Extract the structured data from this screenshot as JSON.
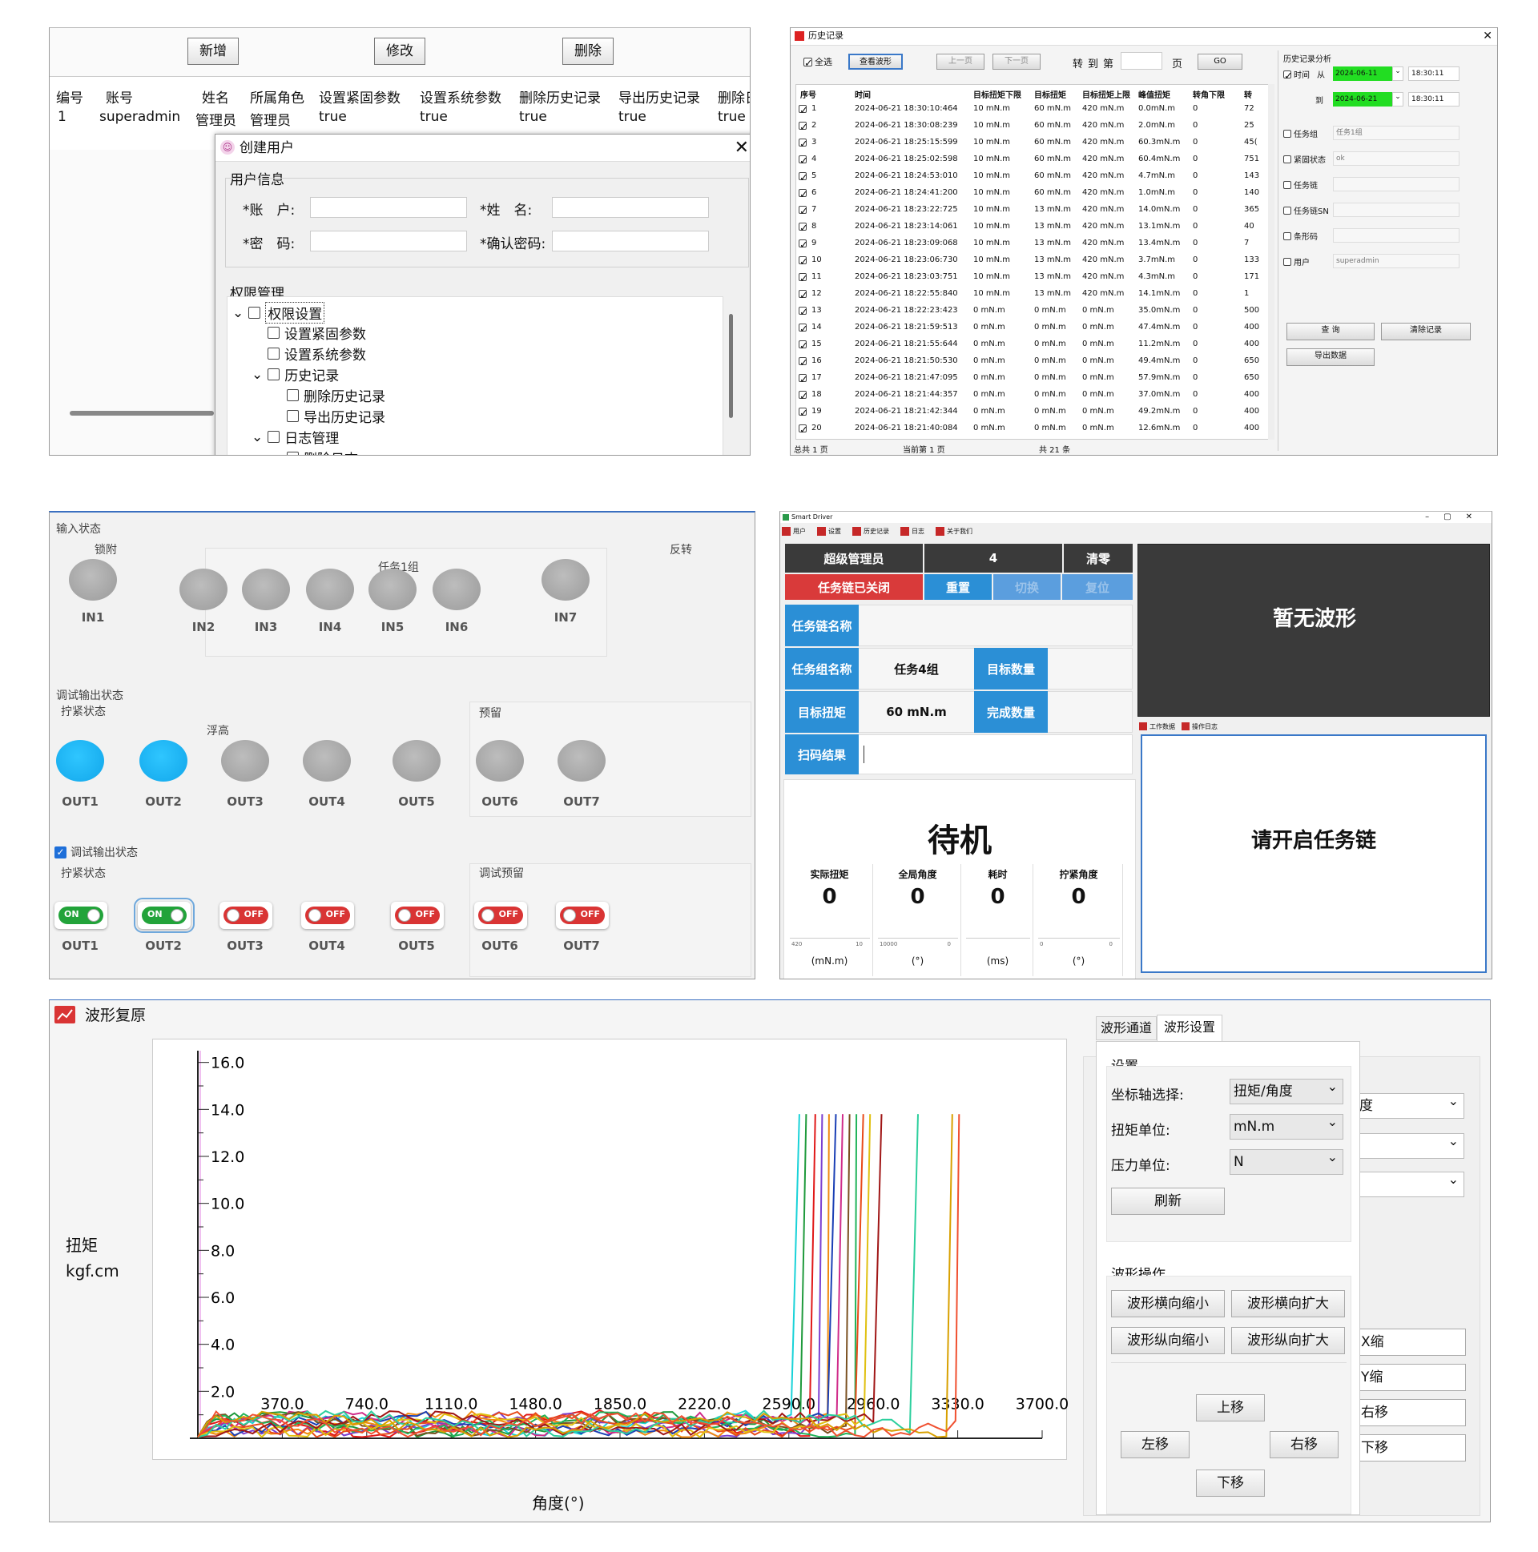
{
  "p1": {
    "buttons": [
      "新增",
      "修改",
      "删除"
    ],
    "headers": [
      "编号",
      "账号",
      "姓名",
      "所属角色",
      "设置紧固参数",
      "设置系统参数",
      "删除历史记录",
      "导出历史记录",
      "删除日"
    ],
    "row": [
      "1",
      "superadmin",
      "管理员",
      "管理员",
      "true",
      "true",
      "true",
      "true",
      "true"
    ],
    "dialog": {
      "title": "创建用户",
      "user_info": "用户信息",
      "account": "*账　户:",
      "surname": "*姓　名:",
      "password": "*密　码:",
      "confirm": "*确认密码:",
      "perm": "权限管理",
      "tree": [
        "权限设置",
        "设置紧固参数",
        "设置系统参数",
        "历史记录",
        "删除历史记录",
        "导出历史记录",
        "日志管理",
        "删除日志"
      ]
    }
  },
  "p2": {
    "title": "历史记录",
    "toolbar": {
      "select_all": "全选",
      "view_wave": "查看波形",
      "prev": "上一页",
      "next": "下一页",
      "goto": "转到第",
      "page": "页",
      "go": "GO"
    },
    "headers": [
      "序号",
      "时间",
      "目标扭矩下限",
      "目标扭矩",
      "目标扭矩上限",
      "峰值扭矩",
      "转角下限",
      "转"
    ],
    "rows": [
      [
        "1",
        "2024-06-21 18:30:10:464",
        "10 mN.m",
        "60 mN.m",
        "420 mN.m",
        "0.0mN.m",
        "0",
        "72"
      ],
      [
        "2",
        "2024-06-21 18:30:08:239",
        "10 mN.m",
        "60 mN.m",
        "420 mN.m",
        "2.0mN.m",
        "0",
        "25"
      ],
      [
        "3",
        "2024-06-21 18:25:15:599",
        "10 mN.m",
        "60 mN.m",
        "420 mN.m",
        "60.3mN.m",
        "0",
        "45("
      ],
      [
        "4",
        "2024-06-21 18:25:02:598",
        "10 mN.m",
        "60 mN.m",
        "420 mN.m",
        "60.4mN.m",
        "0",
        "751"
      ],
      [
        "5",
        "2024-06-21 18:24:53:010",
        "10 mN.m",
        "60 mN.m",
        "420 mN.m",
        "4.7mN.m",
        "0",
        "143"
      ],
      [
        "6",
        "2024-06-21 18:24:41:200",
        "10 mN.m",
        "60 mN.m",
        "420 mN.m",
        "1.0mN.m",
        "0",
        "140"
      ],
      [
        "7",
        "2024-06-21 18:23:22:725",
        "10 mN.m",
        "13 mN.m",
        "420 mN.m",
        "14.0mN.m",
        "0",
        "365"
      ],
      [
        "8",
        "2024-06-21 18:23:14:061",
        "10 mN.m",
        "13 mN.m",
        "420 mN.m",
        "13.1mN.m",
        "0",
        "40"
      ],
      [
        "9",
        "2024-06-21 18:23:09:068",
        "10 mN.m",
        "13 mN.m",
        "420 mN.m",
        "13.4mN.m",
        "0",
        "7"
      ],
      [
        "10",
        "2024-06-21 18:23:06:730",
        "10 mN.m",
        "13 mN.m",
        "420 mN.m",
        "3.7mN.m",
        "0",
        "133"
      ],
      [
        "11",
        "2024-06-21 18:23:03:751",
        "10 mN.m",
        "13 mN.m",
        "420 mN.m",
        "4.3mN.m",
        "0",
        "171"
      ],
      [
        "12",
        "2024-06-21 18:22:55:840",
        "10 mN.m",
        "13 mN.m",
        "420 mN.m",
        "14.1mN.m",
        "0",
        "1"
      ],
      [
        "13",
        "2024-06-21 18:22:23:423",
        "0 mN.m",
        "0 mN.m",
        "0 mN.m",
        "35.0mN.m",
        "0",
        "500"
      ],
      [
        "14",
        "2024-06-21 18:21:59:513",
        "0 mN.m",
        "0 mN.m",
        "0 mN.m",
        "47.4mN.m",
        "0",
        "400"
      ],
      [
        "15",
        "2024-06-21 18:21:55:644",
        "0 mN.m",
        "0 mN.m",
        "0 mN.m",
        "11.2mN.m",
        "0",
        "400"
      ],
      [
        "16",
        "2024-06-21 18:21:50:530",
        "0 mN.m",
        "0 mN.m",
        "0 mN.m",
        "49.4mN.m",
        "0",
        "650"
      ],
      [
        "17",
        "2024-06-21 18:21:47:095",
        "0 mN.m",
        "0 mN.m",
        "0 mN.m",
        "57.9mN.m",
        "0",
        "650"
      ],
      [
        "18",
        "2024-06-21 18:21:44:357",
        "0 mN.m",
        "0 mN.m",
        "0 mN.m",
        "37.0mN.m",
        "0",
        "400"
      ],
      [
        "19",
        "2024-06-21 18:21:42:344",
        "0 mN.m",
        "0 mN.m",
        "0 mN.m",
        "49.2mN.m",
        "0",
        "400"
      ],
      [
        "20",
        "2024-06-21 18:21:40:084",
        "0 mN.m",
        "0 mN.m",
        "0 mN.m",
        "12.6mN.m",
        "0",
        "400"
      ]
    ],
    "footer": {
      "total_pages": "总共 1 页",
      "current": "当前第 1 页",
      "total": "共 21 条"
    },
    "analysis": {
      "title": "历史记录分析",
      "time": "时间",
      "from": "从",
      "to": "到",
      "date_from": "2024-06-11",
      "date_to": "2024-06-21",
      "time_from": "18:30:11",
      "time_to": "18:30:11",
      "filters": [
        {
          "label": "任务组",
          "value": "任务1组"
        },
        {
          "label": "紧固状态",
          "value": "ok"
        },
        {
          "label": "任务链",
          "value": ""
        },
        {
          "label": "任务链SN",
          "value": ""
        },
        {
          "label": "条形码",
          "value": ""
        },
        {
          "label": "用户",
          "value": "superadmin"
        }
      ],
      "query": "查 询",
      "clear": "清除记录",
      "export": "导出数据"
    }
  },
  "p3": {
    "input_title": "输入状态",
    "lock": "锁附",
    "task_group": "任务1组",
    "reverse": "反转",
    "inputs": [
      "IN1",
      "IN2",
      "IN3",
      "IN4",
      "IN5",
      "IN6",
      "IN7"
    ],
    "debug_out_title": "调试输出状态",
    "tighten": "拧紧状态",
    "float": "浮高",
    "reserve": "预留",
    "outputs": [
      "OUT1",
      "OUT2",
      "OUT3",
      "OUT4",
      "OUT5",
      "OUT6",
      "OUT7"
    ],
    "debug_switch_title": "调试输出状态",
    "tighten2": "拧紧状态",
    "debug_reserve": "调试预留",
    "on": "ON",
    "off": "OFF"
  },
  "p4": {
    "window_title": "Smart Driver",
    "menu": [
      "用户",
      "设置",
      "历史记录",
      "日志",
      "关于我们"
    ],
    "admin": "超级管理员",
    "num": "4",
    "clear": "清零",
    "chain_closed": "任务链已关闭",
    "reset": "重置",
    "switch": "切换",
    "restore": "复位",
    "chain_name": "任务链名称",
    "group_name": "任务组名称",
    "group_val": "任务4组",
    "target_count": "目标数量",
    "target_torque": "目标扭矩",
    "torque_val": "60 mN.m",
    "done_count": "完成数量",
    "scan": "扫码结果",
    "standby": "待机",
    "metrics": [
      {
        "label": "实际扭矩",
        "value": "0",
        "min": "420",
        "max": "10",
        "unit": "(mN.m)"
      },
      {
        "label": "全局角度",
        "value": "0",
        "min": "10000",
        "max": "0",
        "unit": "(°)"
      },
      {
        "label": "耗时",
        "value": "0",
        "min": "",
        "max": "",
        "unit": "(ms)"
      },
      {
        "label": "拧紧角度",
        "value": "0",
        "min": "0",
        "max": "0",
        "unit": "(°)"
      }
    ],
    "no_wave": "暂无波形",
    "tabs": [
      "工作数据",
      "操作日志"
    ],
    "prompt": "请开启任务链"
  },
  "p5": {
    "title": "波形复原",
    "ylabel1": "扭矩",
    "ylabel2": "kgf.cm",
    "xlabel": "角度(°)",
    "yticks": [
      "16.0",
      "14.0",
      "12.0",
      "10.0",
      "8.0",
      "6.0",
      "4.0",
      "2.0"
    ],
    "xticks": [
      "370.0",
      "740.0",
      "1110.0",
      "1480.0",
      "1850.0",
      "2220.0",
      "2590.0",
      "2960.0",
      "3330.0",
      "3700.0"
    ],
    "tabs": [
      "波形通道",
      "波形设置"
    ],
    "settings": "设置",
    "axis_sel": "坐标轴选择:",
    "axis_val": "扭矩/角度",
    "torque_unit": "扭矩单位:",
    "torque_val": "mN.m",
    "force_unit": "压力单位:",
    "force_val": "N",
    "refresh": "刷新",
    "wave_ops": "波形操作",
    "h_shrink": "波形横向缩小",
    "h_expand": "波形横向扩大",
    "v_shrink": "波形纵向缩小",
    "v_expand": "波形纵向扩大",
    "up": "上移",
    "left": "左移",
    "right": "右移",
    "down": "下移",
    "bg": {
      "deg": "度",
      "x_shrink": "X缩",
      "y_shrink": "Y缩",
      "right_move": "右移",
      "down_move": "下移"
    }
  },
  "chart_data": {
    "type": "line",
    "xlabel": "角度(°)",
    "ylabel": "扭矩 kgf.cm",
    "ylim": [
      0,
      16.5
    ],
    "xlim": [
      0,
      3700
    ],
    "series": [
      {
        "color": "#19d2d8",
        "rise_at": 2630
      },
      {
        "color": "#1f9a3c",
        "rise_at": 2660
      },
      {
        "color": "#e01818",
        "rise_at": 2700
      },
      {
        "color": "#7b3fd0",
        "rise_at": 2730
      },
      {
        "color": "#f08a10",
        "rise_at": 2760
      },
      {
        "color": "#1a3fb5",
        "rise_at": 2790
      },
      {
        "color": "#d02c8a",
        "rise_at": 2820
      },
      {
        "color": "#7a5020",
        "rise_at": 2850
      },
      {
        "color": "#21b35a",
        "rise_at": 2880
      },
      {
        "color": "#e84a1a",
        "rise_at": 2910
      },
      {
        "color": "#e0c010",
        "rise_at": 2940
      },
      {
        "color": "#a01616",
        "rise_at": 2990
      },
      {
        "color": "#2ccf9d",
        "rise_at": 3150
      },
      {
        "color": "#d8a000",
        "rise_at": 3300
      },
      {
        "color": "#f05030",
        "rise_at": 3330
      }
    ]
  }
}
